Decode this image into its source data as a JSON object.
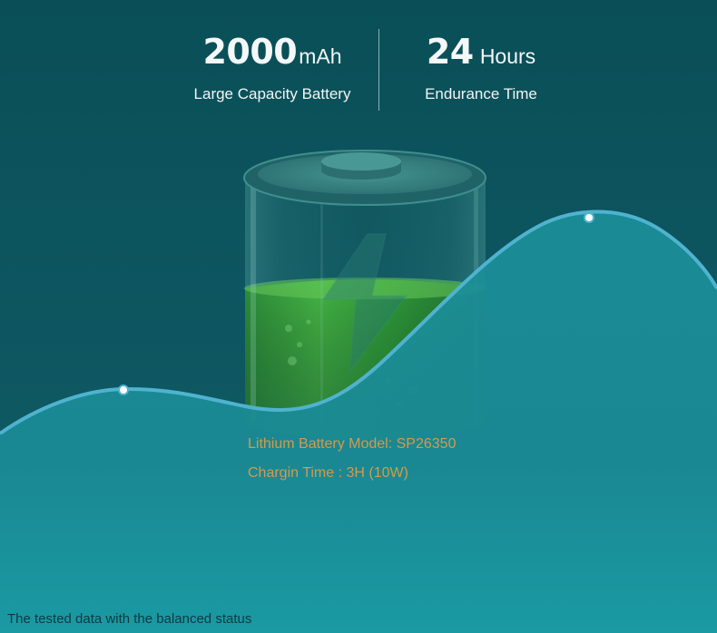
{
  "stats": {
    "capacity": {
      "value": "2000",
      "unit": "mAh",
      "caption": "Large Capacity Battery"
    },
    "endurance": {
      "value": "24",
      "unit": "Hours",
      "caption": "Endurance Time"
    }
  },
  "battery_info": {
    "model": "Lithium Battery Model: SP26350",
    "charging": "Chargin Time : 3H (10W)"
  },
  "footnote": "The tested data with the balanced status",
  "colors": {
    "background": "#0d5560",
    "wave_fill": "#1a8a94",
    "wave_line": "#4fb3cf",
    "charge_green": "#2fae3f",
    "info_text": "#d49a4c"
  },
  "icons": [
    "battery-icon",
    "lightning-bolt-icon"
  ]
}
